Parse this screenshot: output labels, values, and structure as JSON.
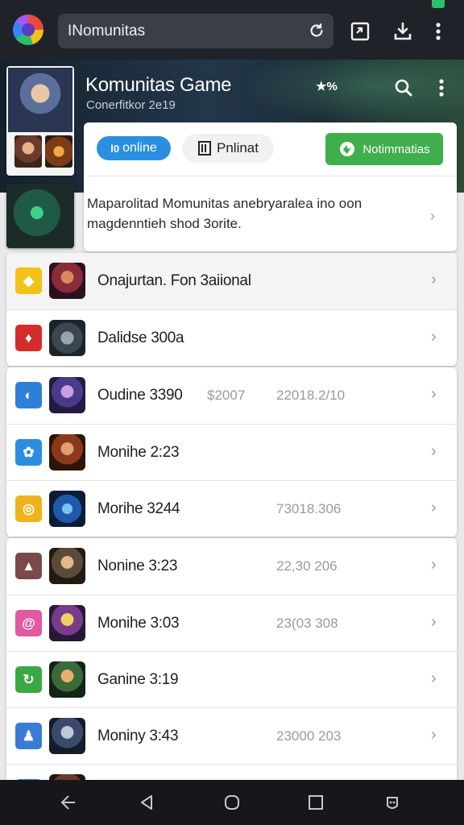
{
  "browser": {
    "url": "INomunitas",
    "icons": [
      "browser-logo",
      "reload-icon",
      "tab-switch-icon",
      "download-icon",
      "more-vertical-icon"
    ]
  },
  "header": {
    "title": "Komunitas Game",
    "subtitle": "Conerfitkor 2e19",
    "star_badge": "★%",
    "icons": [
      "search-icon",
      "more-vertical-icon"
    ]
  },
  "top_card": {
    "chip_online": "online",
    "chip_online_glyph": "l0",
    "chip_plain": "Pnlinat",
    "notif_button": "Notimmatias",
    "description": "Maparolitad Momunitas anebryaralea ino oon magdenntieh shod 3orite."
  },
  "list_groups": [
    {
      "rows": [
        {
          "label": "Onajurtan. Fon 3aiional",
          "meta": "",
          "meta2": "",
          "icon_color": "#f2c21b",
          "icon_glyph": "◆",
          "highlight": true
        },
        {
          "label": "Dalidse 300a",
          "meta": "",
          "meta2": "",
          "icon_color": "#d62b2b",
          "icon_glyph": "♦",
          "highlight": false
        }
      ]
    },
    {
      "rows": [
        {
          "label": "Oudine 3390",
          "meta": "$2007",
          "meta2": "22018.2/10",
          "icon_color": "#2f7ed8",
          "icon_glyph": "◐",
          "highlight": false
        },
        {
          "label": "Monihe 2:23",
          "meta": "",
          "meta2": "",
          "icon_color": "#2a8de0",
          "icon_glyph": "✿",
          "highlight": false
        },
        {
          "label": "Morihe 3244",
          "meta": "",
          "meta2": "73018.306",
          "icon_color": "#f0b21a",
          "icon_glyph": "◎",
          "highlight": false
        }
      ]
    },
    {
      "rows": [
        {
          "label": "Nonine 3:23",
          "meta": "",
          "meta2": "22,30 206",
          "icon_color": "#7a4a4a",
          "icon_glyph": "▲",
          "highlight": false
        },
        {
          "label": "Monihe 3:03",
          "meta": "",
          "meta2": "23(03 308",
          "icon_color": "#e05aa0",
          "icon_glyph": "@",
          "highlight": false
        },
        {
          "label": "Ganine 3:19",
          "meta": "",
          "meta2": "",
          "icon_color": "#3aa845",
          "icon_glyph": "↻",
          "highlight": false
        },
        {
          "label": "Moniny 3:43",
          "meta": "",
          "meta2": "23000 203",
          "icon_color": "#3a7bd5",
          "icon_glyph": "♟",
          "highlight": false
        },
        {
          "label": "",
          "meta": "",
          "meta2": "",
          "icon_color": "#2a8de0",
          "icon_glyph": "",
          "highlight": false
        }
      ]
    }
  ],
  "navbar": {
    "icons": [
      "back-arrow-icon",
      "triangle-back-icon",
      "home-circle-icon",
      "recents-square-icon",
      "assistant-icon"
    ]
  }
}
